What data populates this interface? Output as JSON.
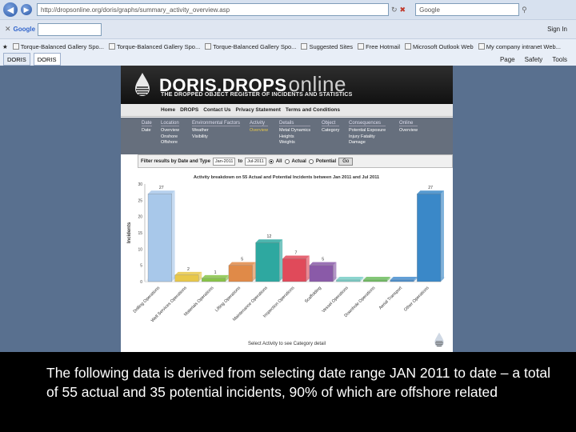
{
  "browser": {
    "url": "http://dropsonline.org/doris/graphs/summary_activity_overview.asp",
    "search_engine": "Google",
    "toolbar_label": "Google",
    "toolbar_right": "Sign In",
    "tabs": [
      "DORIS",
      "DORIS"
    ],
    "favorites": [
      "Torque-Balanced Gallery Spo...",
      "Torque-Balanced Gallery Spo...",
      "Torque-Balanced Gallery Spo...",
      "Suggested Sites",
      "Free Hotmail",
      "Microsoft Outlook Web",
      "My company intranet Web..."
    ],
    "commands": [
      "Page",
      "Safety",
      "Tools"
    ]
  },
  "site": {
    "name": "DORIS.DROPS",
    "name_suffix": "online",
    "tagline": "THE DROPPED OBJECT REGISTER OF INCIDENTS AND STATISTICS",
    "nav": [
      "Home",
      "DROPS",
      "Contact Us",
      "Privacy Statement",
      "Terms and Conditions"
    ],
    "filter_columns": [
      {
        "head": "Date",
        "items": [
          "Date"
        ]
      },
      {
        "head": "Location",
        "items": [
          "Overview",
          "Onshore",
          "Offshore"
        ]
      },
      {
        "head": "Environmental Factors",
        "items": [
          "Weather",
          "Visibility"
        ]
      },
      {
        "head": "Activity",
        "items": [
          "Overview"
        ]
      },
      {
        "head": "Details",
        "items": [
          "Metal Dynamics",
          "Heights",
          "Weights"
        ]
      },
      {
        "head": "Object",
        "items": [
          "Category"
        ]
      },
      {
        "head": "Consequences",
        "items": [
          "Potential Exposure",
          "Injury Fatality",
          "Damage"
        ]
      },
      {
        "head": "Online",
        "items": [
          "Overview"
        ]
      }
    ],
    "filter_bar": {
      "label": "Filter results by Date and Type",
      "from": "Jan-2011",
      "to_label": "to",
      "to": "Jul-2011",
      "options": [
        "All",
        "Actual",
        "Potential"
      ],
      "go": "Go"
    },
    "footer_link": "Select Activity to see Category detail"
  },
  "chart_data": {
    "type": "bar",
    "title": "Activity breakdown on 55 Actual and Potential Incidents between Jan 2011 and Jul 2011",
    "xlabel": "",
    "ylabel": "Incidents",
    "ylim": [
      0,
      30
    ],
    "yticks": [
      0,
      5,
      10,
      15,
      20,
      25,
      30
    ],
    "grid": false,
    "categories": [
      "Drilling Operations",
      "Well Services Operations",
      "Materials Operations",
      "Lifting Operations",
      "Maintenance Operations",
      "Inspection Operations",
      "Scaffolding",
      "Vessel Operations",
      "Downhole Operations",
      "Aerial Transport",
      "Other Operations"
    ],
    "values": [
      27,
      2,
      1,
      5,
      12,
      7,
      5,
      0,
      0,
      0,
      27
    ],
    "colors": [
      "#a8c8ea",
      "#e8c84a",
      "#88c448",
      "#e08a48",
      "#2ea8a0",
      "#e04a5a",
      "#8a5aa8",
      "#7ad0c8",
      "#70c060",
      "#4a90d0",
      "#3a88c8"
    ]
  },
  "caption": "The following data is derived from selecting date range JAN 2011 to date – a total of 55 actual and 35 potential incidents, 90% of which are offshore related"
}
